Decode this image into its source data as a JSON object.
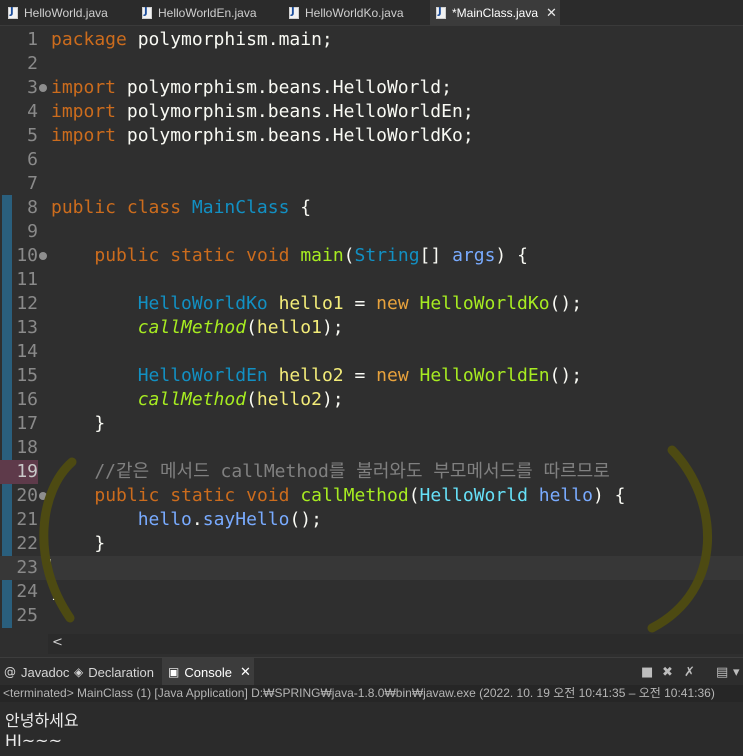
{
  "tabs": [
    {
      "label": "HelloWorld.java",
      "active": false
    },
    {
      "label": "HelloWorldEn.java",
      "active": false
    },
    {
      "label": "HelloWorldKo.java",
      "active": false
    },
    {
      "label": "*MainClass.java",
      "active": true
    }
  ],
  "tab_close_glyph": "✕",
  "lines": [
    {
      "n": "1",
      "tokens": [
        [
          "kw",
          "package"
        ],
        [
          "plain",
          " polymorphism.main;"
        ]
      ]
    },
    {
      "n": "2",
      "tokens": []
    },
    {
      "n": "3",
      "fold": true,
      "tokens": [
        [
          "kw",
          "import"
        ],
        [
          "plain",
          " polymorphism.beans.HelloWorld;"
        ]
      ]
    },
    {
      "n": "4",
      "tokens": [
        [
          "kw",
          "import"
        ],
        [
          "plain",
          " polymorphism.beans.HelloWorldEn;"
        ]
      ]
    },
    {
      "n": "5",
      "tokens": [
        [
          "kw",
          "import"
        ],
        [
          "plain",
          " polymorphism.beans.HelloWorldKo;"
        ]
      ]
    },
    {
      "n": "6",
      "tokens": []
    },
    {
      "n": "7",
      "tokens": []
    },
    {
      "n": "8",
      "tokens": [
        [
          "kw",
          "public"
        ],
        [
          "plain",
          " "
        ],
        [
          "kw",
          "class"
        ],
        [
          "plain",
          " "
        ],
        [
          "ty",
          "MainClass"
        ],
        [
          "plain",
          " {"
        ]
      ]
    },
    {
      "n": "9",
      "tokens": []
    },
    {
      "n": "10",
      "fold": true,
      "tokens": [
        [
          "plain",
          "    "
        ],
        [
          "kw",
          "public"
        ],
        [
          "plain",
          " "
        ],
        [
          "kw",
          "static"
        ],
        [
          "plain",
          " "
        ],
        [
          "kw",
          "void"
        ],
        [
          "plain",
          " "
        ],
        [
          "mth",
          "main"
        ],
        [
          "plain",
          "("
        ],
        [
          "ty",
          "String"
        ],
        [
          "plain",
          "[] "
        ],
        [
          "fld",
          "args"
        ],
        [
          "plain",
          ") {"
        ]
      ]
    },
    {
      "n": "11",
      "tokens": []
    },
    {
      "n": "12",
      "tokens": [
        [
          "plain",
          "        "
        ],
        [
          "ty",
          "HelloWorldKo"
        ],
        [
          "plain",
          " "
        ],
        [
          "var",
          "hello1"
        ],
        [
          "plain",
          " = "
        ],
        [
          "kw2",
          "new"
        ],
        [
          "plain",
          " "
        ],
        [
          "mth",
          "HelloWorldKo"
        ],
        [
          "plain",
          "();"
        ]
      ]
    },
    {
      "n": "13",
      "tokens": [
        [
          "plain",
          "        "
        ],
        [
          "mthi",
          "callMethod"
        ],
        [
          "plain",
          "("
        ],
        [
          "var",
          "hello1"
        ],
        [
          "plain",
          ");"
        ]
      ]
    },
    {
      "n": "14",
      "tokens": []
    },
    {
      "n": "15",
      "tokens": [
        [
          "plain",
          "        "
        ],
        [
          "ty",
          "HelloWorldEn"
        ],
        [
          "plain",
          " "
        ],
        [
          "var",
          "hello2"
        ],
        [
          "plain",
          " = "
        ],
        [
          "kw2",
          "new"
        ],
        [
          "plain",
          " "
        ],
        [
          "mth",
          "HelloWorldEn"
        ],
        [
          "plain",
          "();"
        ]
      ]
    },
    {
      "n": "16",
      "tokens": [
        [
          "plain",
          "        "
        ],
        [
          "mthi",
          "callMethod"
        ],
        [
          "plain",
          "("
        ],
        [
          "var",
          "hello2"
        ],
        [
          "plain",
          ");"
        ]
      ]
    },
    {
      "n": "17",
      "tokens": [
        [
          "plain",
          "    }"
        ]
      ]
    },
    {
      "n": "18",
      "tokens": []
    },
    {
      "n": "19",
      "hl": true,
      "tokens": [
        [
          "cm",
          "    //같은 메서드 callMethod를 불러와도 부모메서드를 따르므로"
        ]
      ]
    },
    {
      "n": "20",
      "fold": true,
      "tokens": [
        [
          "plain",
          "    "
        ],
        [
          "kw",
          "public"
        ],
        [
          "plain",
          " "
        ],
        [
          "kw",
          "static"
        ],
        [
          "plain",
          " "
        ],
        [
          "kw",
          "void"
        ],
        [
          "plain",
          " "
        ],
        [
          "mth",
          "callMethod"
        ],
        [
          "plain",
          "("
        ],
        [
          "tyc",
          "HelloWorld"
        ],
        [
          "plain",
          " "
        ],
        [
          "fld",
          "hello"
        ],
        [
          "plain",
          ") {"
        ]
      ]
    },
    {
      "n": "21",
      "tokens": [
        [
          "plain",
          "        "
        ],
        [
          "fld",
          "hello"
        ],
        [
          "plain",
          "."
        ],
        [
          "fld",
          "sayHello"
        ],
        [
          "plain",
          "();"
        ]
      ]
    },
    {
      "n": "22",
      "tokens": [
        [
          "plain",
          "    }"
        ]
      ]
    },
    {
      "n": "23",
      "current": true,
      "tokens": []
    },
    {
      "n": "24",
      "tokens": [
        [
          "plain",
          "}"
        ]
      ]
    },
    {
      "n": "25",
      "tokens": []
    }
  ],
  "hscroll_arrow": "<",
  "view_tabs": [
    {
      "label": "Javadoc",
      "icon": "@",
      "active": false
    },
    {
      "label": "Declaration",
      "icon": "◈",
      "active": false
    },
    {
      "label": "Console",
      "icon": "▣",
      "active": true
    }
  ],
  "console_status": "<terminated> MainClass (1) [Java Application] D:₩SPRING₩java-1.8.0₩bin₩javaw.exe  (2022. 10. 19 오전 10:41:35 – 오전 10:41:36)",
  "console_output": [
    "안녕하세요",
    "HI~~~"
  ],
  "colors": {
    "accent": "#2a5f7d",
    "annotation": "#4d4a12"
  }
}
